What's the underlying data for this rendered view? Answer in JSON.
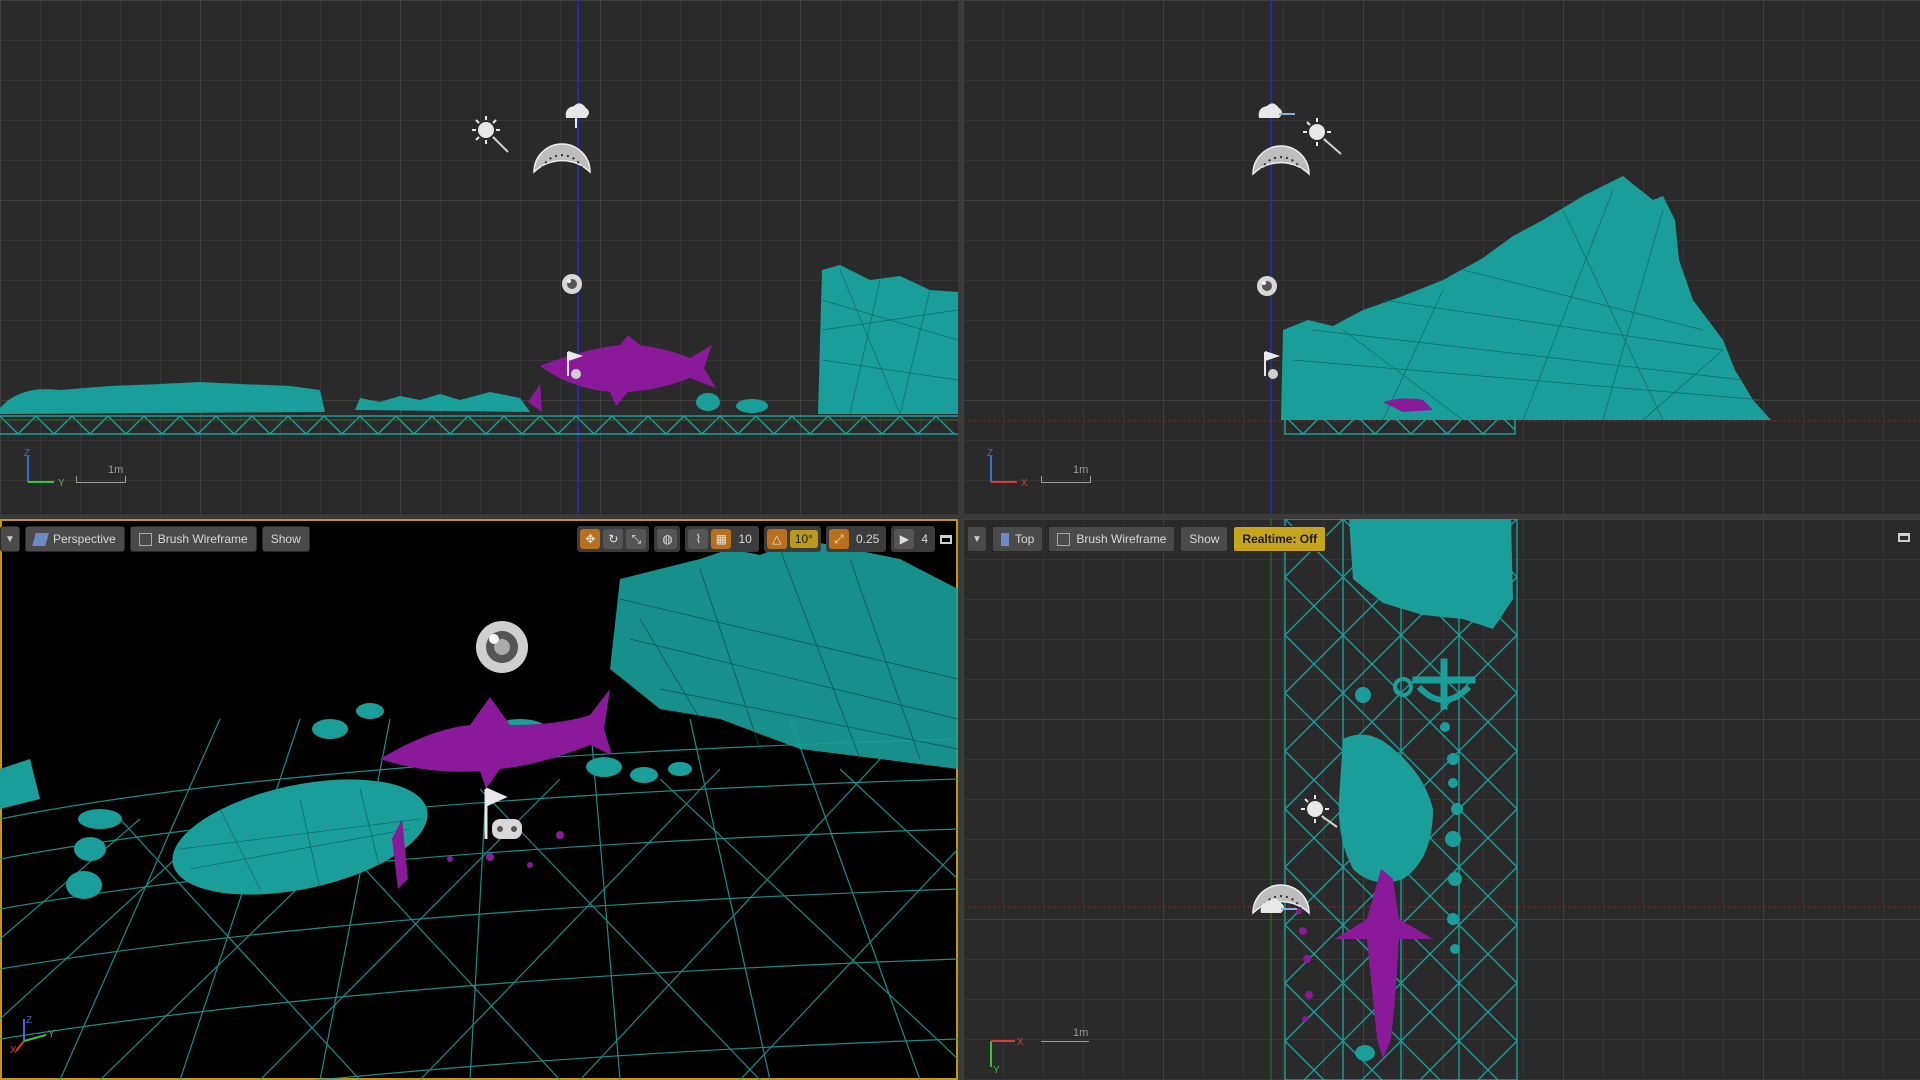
{
  "viewports": {
    "side": {
      "scale_label": "1m",
      "axis_labels": {
        "horizontal": "Y",
        "vertical": "Z"
      }
    },
    "front": {
      "scale_label": "1m",
      "axis_labels": {
        "horizontal": "X",
        "vertical": "Z"
      }
    },
    "perspective": {
      "view_mode": "Perspective",
      "render_mode": "Brush Wireframe",
      "show_label": "Show",
      "grid_snap_value": "10",
      "rotation_snap_value": "10°",
      "scale_snap_value": "0.25",
      "camera_speed_value": "4",
      "axis_labels": {
        "x": "X",
        "y": "Y",
        "z": "Z"
      }
    },
    "top": {
      "view_mode": "Top",
      "render_mode": "Brush Wireframe",
      "show_label": "Show",
      "realtime_label": "Realtime: Off",
      "scale_label": "1m",
      "axis_labels": {
        "horizontal": "X",
        "vertical": "Y"
      }
    }
  },
  "colors": {
    "viewport_bg": "#2a2a2a",
    "perspective_bg": "#000000",
    "wireframe_teal": "#1a9e9a",
    "shark_purple": "#8a1a9a",
    "active_border": "#c89414",
    "realtime_badge": "#c6a51c"
  },
  "icons": [
    "menu-dropdown-icon",
    "perspective-cube-icon",
    "wireframe-icon",
    "translate-icon",
    "rotate-icon",
    "scale-icon",
    "world-icon",
    "surface-snap-icon",
    "grid-icon",
    "angle-icon",
    "scale-snap-icon",
    "camera-speed-icon",
    "maximize-icon",
    "sun-light-icon",
    "skylight-icon",
    "sky-atmosphere-icon",
    "reflection-capture-icon",
    "player-start-icon"
  ]
}
